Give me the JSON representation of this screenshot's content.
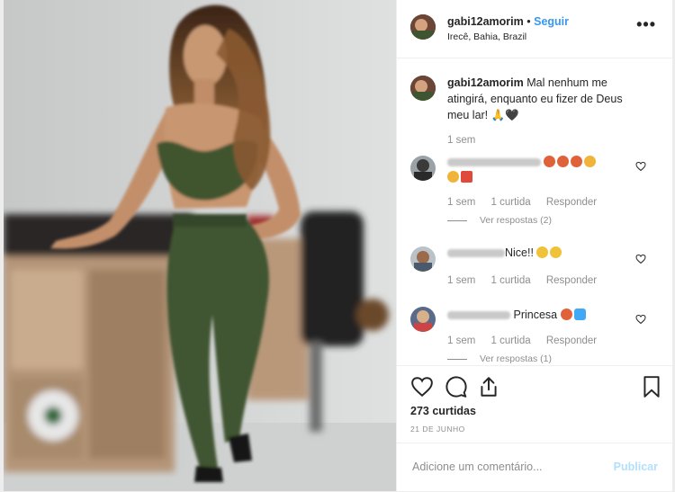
{
  "post": {
    "username": "gabi12amorim",
    "separator": "•",
    "follow_label": "Seguir",
    "location": "Irecê, Bahia, Brazil",
    "more_label": "•••"
  },
  "caption": {
    "username": "gabi12amorim",
    "text": "Mal nenhum me atingirá, enquanto eu fizer de Deus meu lar! 🙏🖤",
    "time": "1 sem"
  },
  "comments": [
    {
      "text": "",
      "time": "1 sem",
      "likes": "1 curtida",
      "reply_label": "Responder",
      "view_replies": "Ver respostas (2)"
    },
    {
      "text": "Nice!!",
      "time": "1 sem",
      "likes": "1 curtida",
      "reply_label": "Responder"
    },
    {
      "text": "Princesa",
      "time": "1 sem",
      "likes": "1 curtida",
      "reply_label": "Responder",
      "view_replies": "Ver respostas (1)"
    }
  ],
  "stats": {
    "likes": "273 curtidas",
    "date": "21 DE JUNHO"
  },
  "comment_box": {
    "placeholder": "Adicione um comentário...",
    "publish_label": "Publicar"
  },
  "colors": {
    "link": "#3897f0",
    "publish_disabled": "#b2dffc",
    "muted": "#8e8e8e",
    "outfit": "#3f5431"
  },
  "icons": [
    "heart-icon",
    "comment-icon",
    "share-icon",
    "bookmark-icon",
    "more-options-icon"
  ]
}
